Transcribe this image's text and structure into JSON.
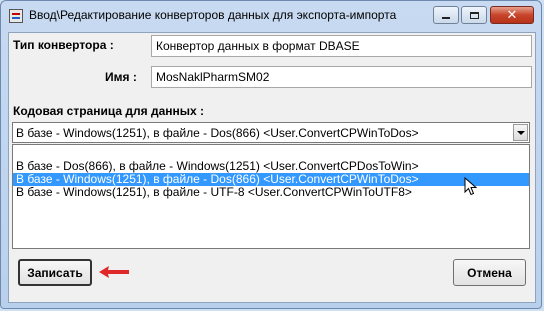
{
  "window": {
    "title": "Ввод\\Редактирование конверторов данных для экспорта-импорта",
    "close_symbol": "✕"
  },
  "form": {
    "type_label": "Тип конвертора :",
    "type_value": "Конвертор данных в формат DBASE",
    "name_label": "Имя :",
    "name_value": "MosNaklPharmSM02",
    "codepage_label": "Кодовая страница для данных :",
    "codepage_selected": "В базе - Windows(1251), в файле - Dos(866) <User.ConvertCPWinToDos>",
    "codepage_options": [
      "В базе - Dos(866), в файле - Windows(1251) <User.ConvertCPDosToWin>",
      "В базе - Windows(1251), в файле - Dos(866) <User.ConvertCPWinToDos>",
      "В базе - Windows(1251), в файле - UTF-8  <User.ConvertCPWinToUTF8>"
    ],
    "highlighted_option_index": 1
  },
  "buttons": {
    "save_label": "Записать",
    "cancel_label": "Отмена"
  },
  "colors": {
    "selection": "#3399ff",
    "annotation_arrow": "#e0282a",
    "close_button": "#c8442a"
  }
}
